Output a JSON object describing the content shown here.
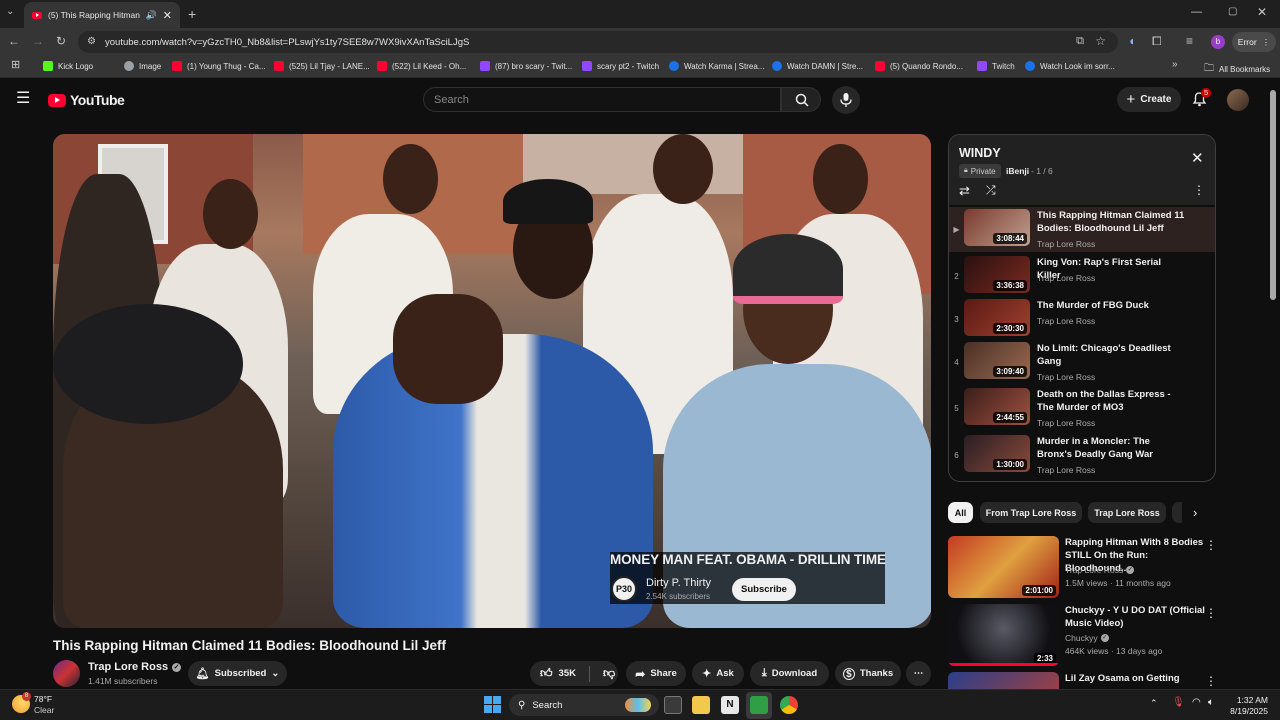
{
  "browser": {
    "tab_title": "(5) This Rapping Hitman Cl",
    "url": "youtube.com/watch?v=yGzcTH0_Nb8&list=PLswjYs1ty7SEE8w7WX9ivXAnTaSciLJgS",
    "profile_initial": "b",
    "error_label": "Error",
    "bookmarks": [
      {
        "label": "Kick Logo",
        "color": "#53fc18"
      },
      {
        "label": "Image",
        "color": "#9aa0a6"
      },
      {
        "label": "(1) Young Thug - Ca...",
        "color": "#ff0033"
      },
      {
        "label": "(525) Lil Tjay - LANE...",
        "color": "#ff0033"
      },
      {
        "label": "(522) Lil Keed - Oh...",
        "color": "#ff0033"
      },
      {
        "label": "(87) bro scary - Twit...",
        "color": "#9146ff"
      },
      {
        "label": "scary pt2 - Twitch",
        "color": "#9146ff"
      },
      {
        "label": "Watch Karma | Strea...",
        "color": "#1a73e8"
      },
      {
        "label": "Watch DAMN | Stre...",
        "color": "#1a73e8"
      },
      {
        "label": "(5) Quando Rondo...",
        "color": "#ff0033"
      },
      {
        "label": "Twitch",
        "color": "#9146ff"
      },
      {
        "label": "Watch Look im sorr...",
        "color": "#1a73e8"
      }
    ],
    "all_bookmarks": "All Bookmarks"
  },
  "youtube": {
    "logo_text": "YouTube",
    "search_placeholder": "Search",
    "create_label": "Create",
    "notification_count": "5"
  },
  "video": {
    "overlay_title": "MONEY MAN FEAT. OBAMA - DRILLIN TIME",
    "overlay_channel": "Dirty P. Thirty",
    "overlay_logo": "P30",
    "overlay_subs": "2.54K subscribers",
    "overlay_subscribe": "Subscribe",
    "title": "This Rapping Hitman Claimed 11 Bodies: Bloodhound Lil Jeff",
    "channel": "Trap Lore Ross",
    "subscribers": "1.41M subscribers",
    "subscribed_label": "Subscribed",
    "likes": "35K",
    "share": "Share",
    "ask": "Ask",
    "download": "Download",
    "thanks": "Thanks"
  },
  "playlist": {
    "title": "WINDY",
    "privacy": "Private",
    "owner": "iBenji",
    "position": "1 / 6",
    "items": [
      {
        "index": "▶",
        "title": "This Rapping Hitman Claimed 11 Bodies: Bloodhound Lil Jeff",
        "channel": "Trap Lore Ross",
        "duration": "3:08:44",
        "thumb": "#7a3a2e"
      },
      {
        "index": "2",
        "title": "King Von: Rap's First Serial Killer",
        "channel": "Trap Lore Ross",
        "duration": "3:36:38",
        "thumb": "#5a1a14"
      },
      {
        "index": "3",
        "title": "The Murder of FBG Duck",
        "channel": "Trap Lore Ross",
        "duration": "2:30:30",
        "thumb": "#6b2a1f"
      },
      {
        "index": "4",
        "title": "No Limit: Chicago's Deadliest Gang",
        "channel": "Trap Lore Ross",
        "duration": "3:09:40",
        "thumb": "#5e3a30"
      },
      {
        "index": "5",
        "title": "Death on the Dallas Express - The Murder of MO3",
        "channel": "Trap Lore Ross",
        "duration": "2:44:55",
        "thumb": "#4d2a24"
      },
      {
        "index": "6",
        "title": "Murder in a Moncler: The Bronx's Deadly Gang War",
        "channel": "Trap Lore Ross",
        "duration": "1:30:00",
        "thumb": "#3e2a2a"
      }
    ]
  },
  "filters": [
    "All",
    "From Trap Lore Ross",
    "Trap Lore Ross"
  ],
  "recommendations": [
    {
      "title": "Rapping Hitman With 8 Bodies STILL On the Run: Bloodhound...",
      "channel": "Trap Lore Ross",
      "views": "1.5M views · 11 months ago",
      "duration": "2:01:00",
      "thumb": "#b8341f"
    },
    {
      "title": "Chuckyy - Y U DO DAT (Official Music Video)",
      "channel": "Chuckyy",
      "views": "464K views · 13 days ago",
      "duration": "2:33",
      "thumb": "#2a2a2e"
    },
    {
      "title": "Lil Zay Osama on Getting",
      "channel": "",
      "views": "",
      "duration": "",
      "thumb": "#3a3f6a"
    }
  ],
  "taskbar": {
    "temp": "78°F",
    "weather": "Clear",
    "weather_badge": "8",
    "search": "Search",
    "time": "1:32 AM",
    "date": "8/19/2025"
  }
}
